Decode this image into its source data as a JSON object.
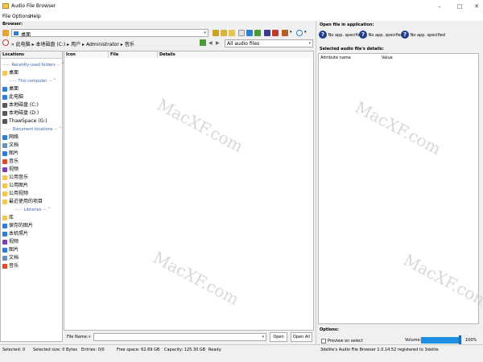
{
  "window": {
    "title": "Audio File Browser"
  },
  "menu": [
    "File",
    "Options",
    "Help"
  ],
  "browser": {
    "label": "Browser:",
    "address": "桌面",
    "breadcrumb": [
      "此电脑",
      "本地磁盘 (C:)",
      "用户",
      "Administrator",
      "音乐"
    ],
    "filter": "All audio files"
  },
  "tree": {
    "header": "Locations",
    "groups": [
      {
        "title": "Recently-used folders",
        "items": [
          {
            "label": "桌面",
            "icon": "folder-icon",
            "color": "#f2c94c"
          }
        ]
      },
      {
        "title": "This computer",
        "items": [
          {
            "label": "桌面",
            "icon": "desktop-icon",
            "color": "#2a7fd4"
          },
          {
            "label": "此电脑",
            "icon": "computer-icon",
            "color": "#2a7fd4"
          },
          {
            "label": "本地磁盘 (C:)",
            "icon": "drive-icon",
            "color": "#555555"
          },
          {
            "label": "本地磁盘 (D:)",
            "icon": "drive-icon",
            "color": "#555555"
          },
          {
            "label": "ThawSpace (G:)",
            "icon": "drive-icon",
            "color": "#555555"
          }
        ]
      },
      {
        "title": "Document locations",
        "items": [
          {
            "label": "网络",
            "icon": "network-icon",
            "color": "#2a7fd4"
          },
          {
            "label": "文档",
            "icon": "documents-icon",
            "color": "#6b8fb8"
          },
          {
            "label": "图片",
            "icon": "pictures-icon",
            "color": "#2a7fd4"
          },
          {
            "label": "音乐",
            "icon": "music-icon",
            "color": "#e04a2a"
          },
          {
            "label": "视频",
            "icon": "video-icon",
            "color": "#7b3fb8"
          },
          {
            "label": "公用音乐",
            "icon": "folder-icon",
            "color": "#f2c94c"
          },
          {
            "label": "公用图片",
            "icon": "folder-icon",
            "color": "#f2c94c"
          },
          {
            "label": "公用视频",
            "icon": "folder-icon",
            "color": "#f2c94c"
          },
          {
            "label": "最近使用的项目",
            "icon": "recent-icon",
            "color": "#f2c94c"
          }
        ]
      },
      {
        "title": "Libraries",
        "items": [
          {
            "label": "库",
            "icon": "library-icon",
            "color": "#f2c94c"
          },
          {
            "label": "保存的图片",
            "icon": "pictures-icon",
            "color": "#2a7fd4"
          },
          {
            "label": "本机照片",
            "icon": "pictures-icon",
            "color": "#2a7fd4"
          },
          {
            "label": "视频",
            "icon": "video-icon",
            "color": "#7b3fb8"
          },
          {
            "label": "图片",
            "icon": "pictures-icon",
            "color": "#2a7fd4"
          },
          {
            "label": "文档",
            "icon": "documents-icon",
            "color": "#6b8fb8"
          },
          {
            "label": "音乐",
            "icon": "music-icon",
            "color": "#e04a2a"
          }
        ]
      }
    ]
  },
  "filelist": {
    "columns": [
      "Icon",
      "File",
      "Details"
    ]
  },
  "bottom": {
    "filename_label": "File Name:",
    "open": "Open",
    "open_all": "Open All"
  },
  "right": {
    "open_in_label": "Open file in application:",
    "apps": [
      "No app. specified",
      "No app. specified",
      "No app. specified"
    ],
    "details_label": "Selected audio file's details:",
    "details_cols": [
      "Attribute name",
      "Value"
    ],
    "options_label": "Options:",
    "preview": "Preview on select",
    "volume_label": "Volume:",
    "volume": "100%",
    "volume_level": 1.0
  },
  "status": {
    "selected": "Selected: 0",
    "selected_size": "Selected size: 0 Bytes",
    "entries": "Entries: 0/0",
    "free": "Free space: 62.69 GB",
    "capacity": "Capacity: 125.30 GB",
    "ready": "Ready.",
    "registration": "3delite's Audio File Browser 1.0.14.52 registered to 3delite"
  },
  "watermark": "MacXF.com",
  "colors": {
    "accent": "#1f3e8c",
    "volume": "#1e8fe0"
  }
}
